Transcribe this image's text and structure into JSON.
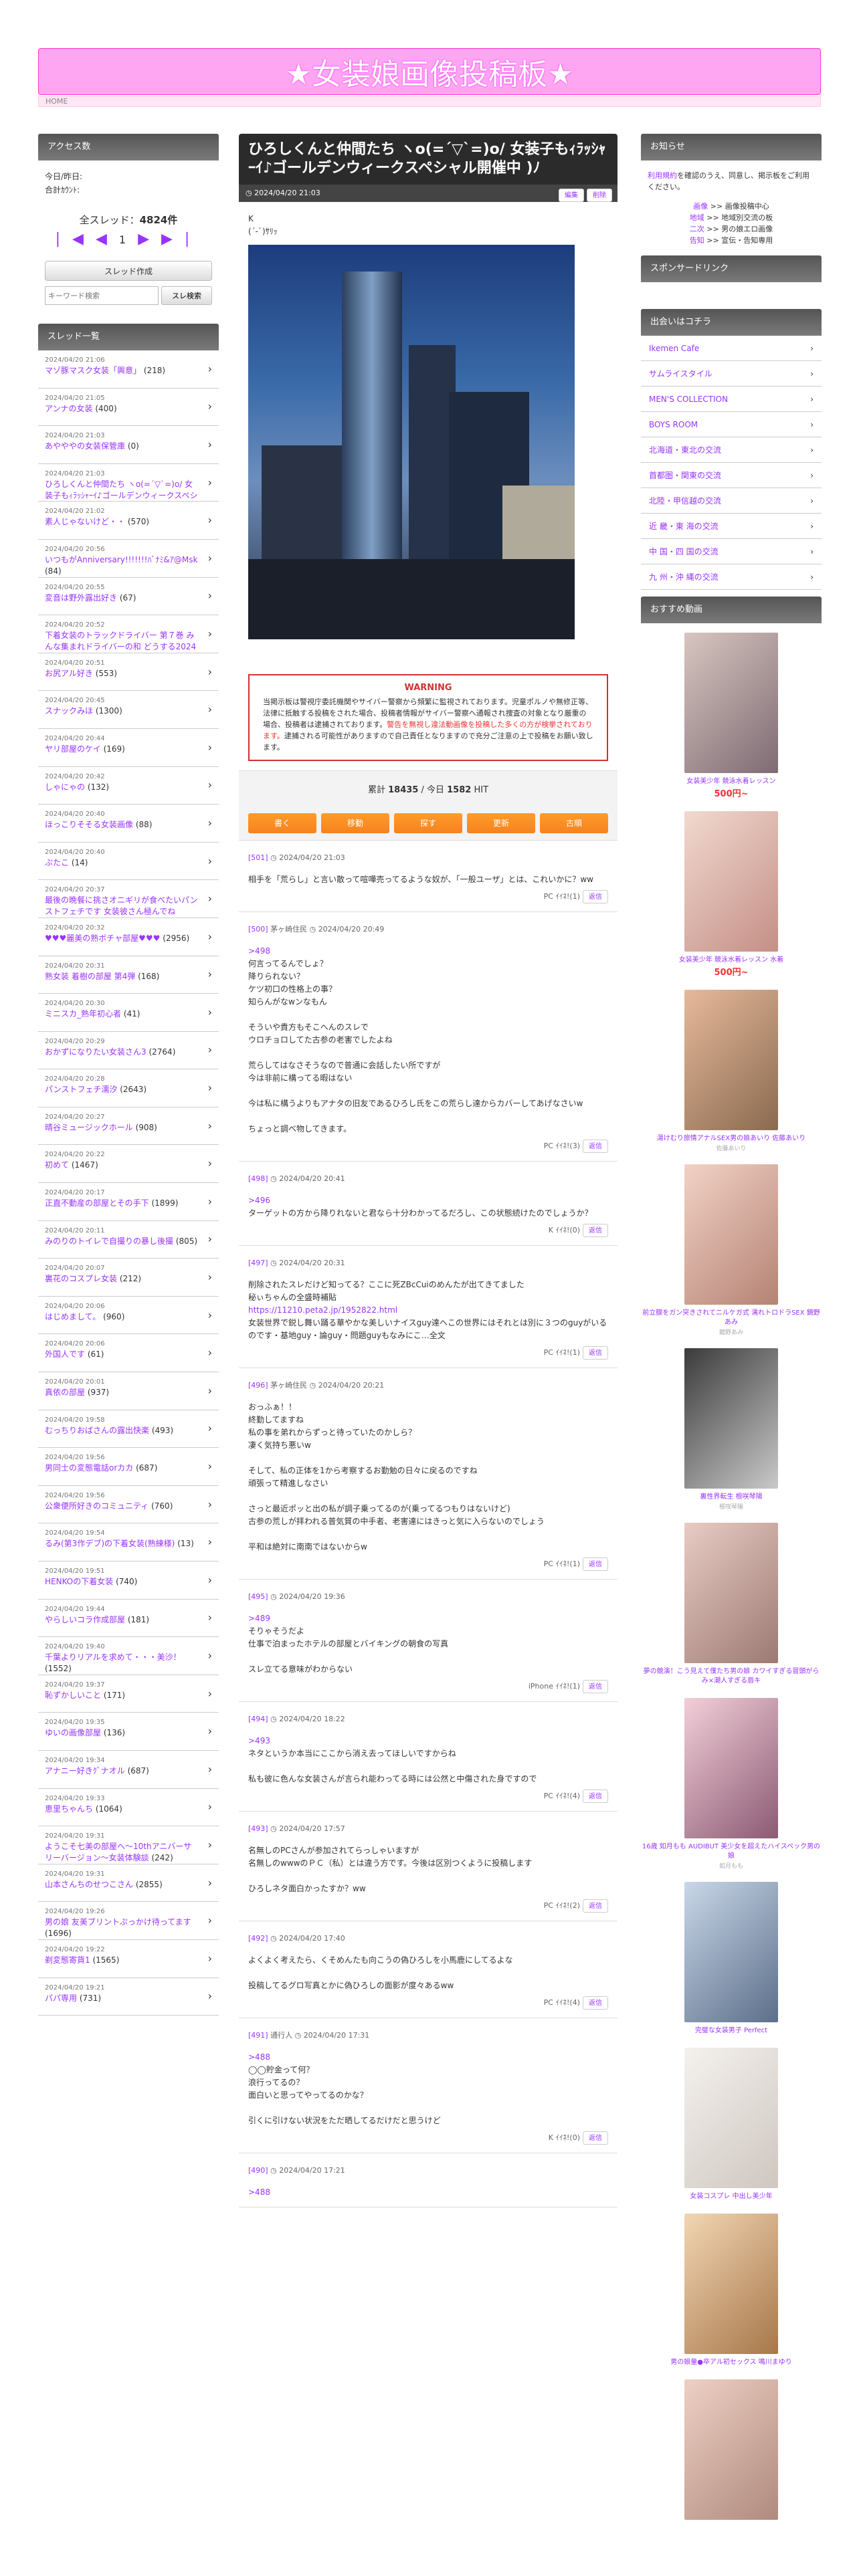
{
  "site": {
    "title": "★女装娘画像投稿板★",
    "home": "HOME"
  },
  "left": {
    "access_head": "アクセス数",
    "access_lines": [
      "今日/昨日:",
      "合計ｶｳﾝﾄ:"
    ],
    "total_label": "全スレッド：",
    "total_value": "4824件",
    "pager_page": "1",
    "create_btn": "スレッド作成",
    "search_placeholder": "キーワード検索",
    "search_btn": "スレ検索",
    "list_head": "スレッド一覧",
    "threads": [
      {
        "date": "2024/04/20 21:06",
        "title": "マゾ豚マスク女装「興意」",
        "count": "(218)"
      },
      {
        "date": "2024/04/20 21:05",
        "title": "アンナの女装",
        "count": "(400)"
      },
      {
        "date": "2024/04/20 21:03",
        "title": "あやややの女装保管庫",
        "count": "(0)"
      },
      {
        "date": "2024/04/20 21:03",
        "title": "ひろしくんと仲間たち ヽo(=´▽`=)o/ 女装子もｨﾗｯｼｬｰｲ♪ゴールデンウィークスペシャル開催中",
        "count": "(402)"
      },
      {
        "date": "2024/04/20 21:02",
        "title": "素人じゃないけど・・",
        "count": "(570)"
      },
      {
        "date": "2024/04/20 20:56",
        "title": "いつもがAnniversary!!!!!!!ﾊﾞﾅﾐ&ｱ@Msk",
        "count": "(84)"
      },
      {
        "date": "2024/04/20 20:55",
        "title": "変音は野外露出好き",
        "count": "(67)"
      },
      {
        "date": "2024/04/20 20:52",
        "title": "下着女装のトラックドライバー 第７巻 みんな集まれドライバーの和 どうする2024年問題",
        "count": "(1277)"
      },
      {
        "date": "2024/04/20 20:51",
        "title": "お尻アル好き",
        "count": "(553)"
      },
      {
        "date": "2024/04/20 20:45",
        "title": "スナックみほ",
        "count": "(1300)"
      },
      {
        "date": "2024/04/20 20:44",
        "title": "ヤリ部屋のケイ",
        "count": "(169)"
      },
      {
        "date": "2024/04/20 20:42",
        "title": "しゃにゃの",
        "count": "(132)"
      },
      {
        "date": "2024/04/20 20:40",
        "title": "ほっこりそそる女装画像",
        "count": "(88)"
      },
      {
        "date": "2024/04/20 20:40",
        "title": "ぷたこ",
        "count": "(14)"
      },
      {
        "date": "2024/04/20 20:37",
        "title": "最後の晩餐に挑さオニギリが食べたいパンストフェチです 女装彼さん極んでね",
        "count": "(1122)"
      },
      {
        "date": "2024/04/20 20:32",
        "title": "♥♥♥麗美の熟ボチャ部屋♥♥♥",
        "count": "(2956)"
      },
      {
        "date": "2024/04/20 20:31",
        "title": "熟女装 着樹の部屋 第4弾",
        "count": "(168)"
      },
      {
        "date": "2024/04/20 20:30",
        "title": "ミニスカ_熟年初心者",
        "count": "(41)"
      },
      {
        "date": "2024/04/20 20:29",
        "title": "おかずになりたい女装さん3",
        "count": "(2764)"
      },
      {
        "date": "2024/04/20 20:28",
        "title": "パンストフェチ濡汐",
        "count": "(2643)"
      },
      {
        "date": "2024/04/20 20:27",
        "title": "晴谷ミュージックホール",
        "count": "(908)"
      },
      {
        "date": "2024/04/20 20:22",
        "title": "初めて",
        "count": "(1467)"
      },
      {
        "date": "2024/04/20 20:17",
        "title": "正直不動産の部屋とその手下",
        "count": "(1899)"
      },
      {
        "date": "2024/04/20 20:11",
        "title": "みのりのトイレで自撮りの暴し後撮",
        "count": "(805)"
      },
      {
        "date": "2024/04/20 20:07",
        "title": "裏花のコスプレ女装",
        "count": "(212)"
      },
      {
        "date": "2024/04/20 20:06",
        "title": "はじめまして。",
        "count": "(960)"
      },
      {
        "date": "2024/04/20 20:06",
        "title": "外国人です",
        "count": "(61)"
      },
      {
        "date": "2024/04/20 20:01",
        "title": "真依の部屋",
        "count": "(937)"
      },
      {
        "date": "2024/04/20 19:58",
        "title": "むっちりおばさんの露出快楽",
        "count": "(493)"
      },
      {
        "date": "2024/04/20 19:56",
        "title": "男同士の変態電話orカカ",
        "count": "(687)"
      },
      {
        "date": "2024/04/20 19:56",
        "title": "公衆便所好きのコミュニティ",
        "count": "(760)"
      },
      {
        "date": "2024/04/20 19:54",
        "title": "るみ(第3作デブ)の下着女装(熟練様)",
        "count": "(13)"
      },
      {
        "date": "2024/04/20 19:51",
        "title": "HENKOの下着女装",
        "count": "(740)"
      },
      {
        "date": "2024/04/20 19:44",
        "title": "やらしいコラ作成部屋",
        "count": "(181)"
      },
      {
        "date": "2024/04/20 19:40",
        "title": "千葉よりリアルを求めて・・・美沙！",
        "count": "(1552)"
      },
      {
        "date": "2024/04/20 19:37",
        "title": "恥ずかしいこと",
        "count": "(171)"
      },
      {
        "date": "2024/04/20 19:35",
        "title": "ゆいの画像部屋",
        "count": "(136)"
      },
      {
        "date": "2024/04/20 19:34",
        "title": "アナニー好きｸﾞナオル",
        "count": "(687)"
      },
      {
        "date": "2024/04/20 19:33",
        "title": "恵里ちゃんち",
        "count": "(1064)"
      },
      {
        "date": "2024/04/20 19:31",
        "title": "ようこそ七美の部屋へ〜10thアニバーサリーバージョン〜女装体験談",
        "count": "(242)"
      },
      {
        "date": "2024/04/20 19:31",
        "title": "山本さんちのせつこさん",
        "count": "(2855)"
      },
      {
        "date": "2024/04/20 19:26",
        "title": "男の娘 友美ブリントぷっかけ待ってます",
        "count": "(1696)"
      },
      {
        "date": "2024/04/20 19:22",
        "title": "剃変態寄貨1",
        "count": "(1565)"
      },
      {
        "date": "2024/04/20 19:21",
        "title": "パパ専用",
        "count": "(731)"
      }
    ]
  },
  "thread": {
    "title": "ひろしくんと仲間たち ヽo(=´▽`=)o/ 女装子もｨﾗｯｼｬｰｲ♪ゴールデンウィークスペシャル開催中 )ﾉ",
    "date": "2024/04/20 21:03",
    "edit": "編集",
    "del": "削除",
    "op_lines": [
      "K",
      "(´-`)ｻﾘｯ"
    ],
    "warn_title": "WARNING",
    "warn_text": "当掲示板は警視庁委託機関やサイバー警察から頻繁に監視されております。児童ポルノや無修正等、法律に抵触する投稿をされた場合、投稿者情報がサイバー警察へ通報され捜査の対象となり厳重の場合、投稿者は逮捕されております。",
    "warn_red": "警告を無視し違法動画像を投稿した多くの方が検挙されております。",
    "warn_tail": "逮捕される可能性がありますので自己責任となりますので充分ご注意の上で投稿をお願い致します。",
    "counter_label": "累計",
    "counter_total": "18435",
    "counter_sep": "/ 今日",
    "counter_today": "1582",
    "counter_unit": "HIT",
    "actions": [
      "書く",
      "移動",
      "探す",
      "更新",
      "古順"
    ],
    "reply_btn": "返信",
    "posts": [
      {
        "no": "[501]",
        "name": "",
        "date": "2024/04/20 21:03",
        "anchor": "",
        "lines": [
          "相手を「荒らし」と言い散って喧嘩売ってるような奴が、「一般ユーザ」とは、これいかに？ww"
        ],
        "foot": "PC ｲｲﾈ!",
        "likes": "(1)"
      },
      {
        "no": "[500]",
        "name": "茅ヶ崎住民",
        "date": "2024/04/20 20:49",
        "anchor": ">498",
        "lines": [
          "何言ってるんでしょ？",
          "降りられない？",
          "ケツ初口の性格上の事？",
          "知らんがなwンなもん",
          "",
          "そういや貴方もそこへんのスレで",
          "ウロチョロしてた古参の老害でしたよね",
          "",
          "荒らしてはなさそうなので普通に会話したい所ですが",
          "今は非前に構ってる暇はない",
          "",
          "今は私に構うよりもアナタの旧友であるひろし氏をこの荒らし達からカバーしてあげなさいw",
          "",
          "ちょっと調べ物してきます。"
        ],
        "foot": "PC ｲｲﾈ!",
        "likes": "(3)"
      },
      {
        "no": "[498]",
        "name": "",
        "date": "2024/04/20 20:41",
        "anchor": ">496",
        "lines": [
          "ターゲットの方から降りれないと君なら十分わかってるだろし、この状態続けたのでしょうか？"
        ],
        "foot": "K ｲｲﾈ!",
        "likes": "(0)"
      },
      {
        "no": "[497]",
        "name": "",
        "date": "2024/04/20 20:31",
        "anchor": "",
        "lines": [
          "削除されたスレだけど知ってる？ここに死ZBcCuiのめんたが出てきてました",
          "秘ぃちゃんの全盛時補貼",
          "https://11210.peta2.jp/1952822.html",
          "女装世界で鋭し舞い踊る華やかな美しいナイスguy達へこの世界にはそれとは別に３つのguyがいるのです・基地guy・論guy・問題guyもなみにこ…全文"
        ],
        "foot": "PC ｲｲﾈ!",
        "likes": "(1)"
      },
      {
        "no": "[496]",
        "name": "茅ヶ崎住民",
        "date": "2024/04/20 20:21",
        "anchor": "",
        "lines": [
          "おっふぁ！！",
          "終勤してますね",
          "私の事を弟れからずっと待っていたのかしら？",
          "凄く気持ち悪いw",
          "",
          "そして、私の正体を1から考察するお勤勉の日々に戻るのですね",
          "頑張って精進しなさい",
          "",
          "さっと最近ポッと出の私が調子乗ってるのが(乗ってるつもりはないけど)",
          "古参の荒しが拝われる普気質の中手者、老害達にはきっと気に入らないのでしょう",
          "",
          "平和は絶対に南南ではないからw"
        ],
        "foot": "PC ｲｲﾈ!",
        "likes": "(1)"
      },
      {
        "no": "[495]",
        "name": "",
        "date": "2024/04/20 19:36",
        "anchor": ">489",
        "lines": [
          "そりゃそうだよ",
          "仕事で泊まったホテルの部屋とバイキングの朝食の写真",
          "",
          "スレ立てる意味がわからない"
        ],
        "foot": "iPhone ｲｲﾈ!",
        "likes": "(1)"
      },
      {
        "no": "[494]",
        "name": "",
        "date": "2024/04/20 18:22",
        "anchor": ">493",
        "lines": [
          "ネタというか本当にここから消え去ってほしいですからね",
          "",
          "私も彼に色んな女装さんが言られ能わってる時には公然と中傷された身ですので"
        ],
        "foot": "PC ｲｲﾈ!",
        "likes": "(4)"
      },
      {
        "no": "[493]",
        "name": "",
        "date": "2024/04/20 17:57",
        "anchor": "",
        "lines": [
          "名無しのPCさんが参加されてらっしゃいますが",
          "名無しのwwwのＰＣ（私）とは違う方です。今後は区別つくように投稿します",
          "",
          "ひろしネタ面白かったすか？ww"
        ],
        "foot": "PC ｲｲﾈ!",
        "likes": "(2)"
      },
      {
        "no": "[492]",
        "name": "",
        "date": "2024/04/20 17:40",
        "anchor": "",
        "lines": [
          "よくよく考えたら、くそめんたも向こうの偽ひろしを小馬鹿にしてるよな",
          "",
          "投稿してるグロ写真とかに偽ひろしの面影が度々あるww"
        ],
        "foot": "PC ｲｲﾈ!",
        "likes": "(4)"
      },
      {
        "no": "[491]",
        "name": "通行人",
        "date": "2024/04/20 17:31",
        "anchor": ">488",
        "lines": [
          "◯◯貯金って何？",
          "浪行ってるの？",
          "面白いと思ってやってるのかな？",
          "",
          "引くに引けない状況をただ晒してるだけだと思うけど"
        ],
        "foot": "K ｲｲﾈ!",
        "likes": "(0)"
      },
      {
        "no": "[490]",
        "name": "",
        "date": "2024/04/20 17:21",
        "anchor": ">488",
        "lines": [],
        "foot": "",
        "likes": ""
      }
    ]
  },
  "right": {
    "notice_head": "お知らせ",
    "notice_text1": "利用規約",
    "notice_text2": "を確認のうえ、同意し、掲示板をご利用ください。",
    "notice_links": [
      {
        "a": "画像",
        "b": ">> 画像投稿中心"
      },
      {
        "a": "地域",
        "b": ">> 地域別交流の板"
      },
      {
        "a": "二次",
        "b": ">> 男の娘エロ画像"
      },
      {
        "a": "告知",
        "b": ">> 宣伝・告知専用"
      }
    ],
    "sponsor_head": "スポンサードリンク",
    "meet_head": "出会いはコチラ",
    "meet_links": [
      "Ikemen Cafe",
      "サムライスタイル",
      "MEN'S COLLECTION",
      "BOYS ROOM",
      "北海道・東北の交流",
      "首都圏・関東の交流",
      "北陸・甲信越の交流",
      "近 畿・東 海の交流",
      "中 国・四 国の交流",
      "九 州・沖 縄の交流"
    ],
    "video_head": "おすすめ動画",
    "videos": [
      {
        "title": "女装美少年 競泳水着レッスン",
        "price": "500円~",
        "actor": "",
        "c1": "#d8c6c0",
        "c2": "#7e6b74"
      },
      {
        "title": "女装美少年 競泳水着レッスン 水着",
        "price": "500円~",
        "actor": "",
        "c1": "#f1d9cf",
        "c2": "#c48f86"
      },
      {
        "title": "湯けむり旅情アナルSEX男の娘あいり 佐藤あいり",
        "price": "",
        "actor": "佐藤あいり",
        "c1": "#e7b99b",
        "c2": "#8a6a4f"
      },
      {
        "title": "前立腺をガン突きされてニルケガ式 濡れトロドラSEX 鏡野あみ",
        "price": "",
        "actor": "鏡野あみ",
        "c1": "#f2d2c6",
        "c2": "#b48374"
      },
      {
        "title": "裏性界転生 根咲琴陽",
        "price": "",
        "actor": "根咲琴陽",
        "c1": "#3b3b3b",
        "c2": "#c9c9c9"
      },
      {
        "title": "夢の競演！こう見えて僕たち男の娘 カワイすぎる冒頭がらみ×潮人すぎる唇キ",
        "price": "",
        "actor": "",
        "c1": "#e8ccc3",
        "c2": "#9c7a73"
      },
      {
        "title": "16歳 如月もも AUDIBUT 美少女を超えたハイスペック男の娘",
        "price": "",
        "actor": "如月もも",
        "c1": "#f3cfd8",
        "c2": "#8b5a74"
      },
      {
        "title": "完璧な女装男子 Perfect",
        "price": "",
        "actor": "",
        "c1": "#c9d7e8",
        "c2": "#5c6f8a"
      },
      {
        "title": "女装コスプレ 中出し美少年",
        "price": "",
        "actor": "",
        "c1": "#f4f1ee",
        "c2": "#cfc7c0"
      },
      {
        "title": "男の娘童●卒アル初セックス 鳴川まゆり",
        "price": "",
        "actor": "",
        "c1": "#f2d6b3",
        "c2": "#a7774a"
      },
      {
        "title": "",
        "price": "",
        "actor": "",
        "c1": "#eed0c4",
        "c2": "#b08a7e"
      }
    ]
  }
}
